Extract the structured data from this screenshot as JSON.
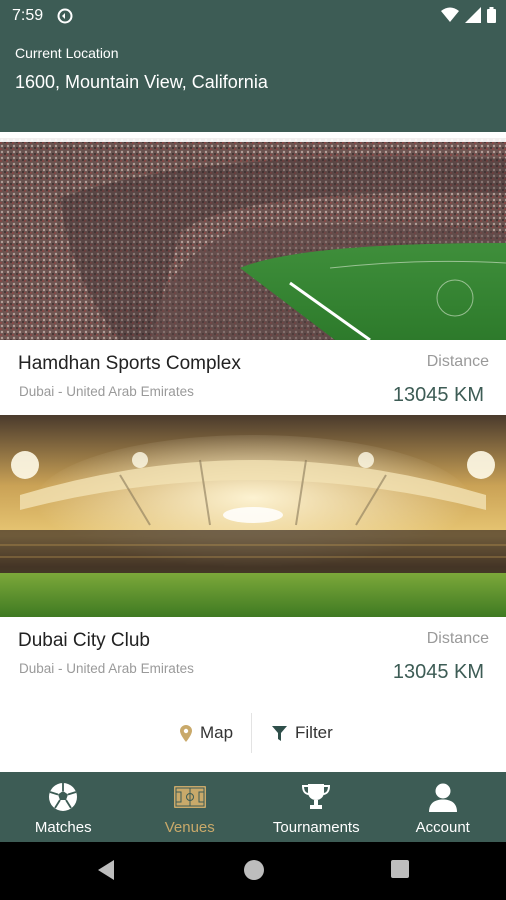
{
  "status_bar": {
    "time": "7:59"
  },
  "header": {
    "label": "Current Location",
    "location": "1600, Mountain View, California"
  },
  "venues": [
    {
      "name": "Hamdhan Sports Complex",
      "country": "Dubai - United Arab Emirates",
      "distance_label": "Distance",
      "distance_value": "13045 KM"
    },
    {
      "name": "Dubai City Club",
      "country": "Dubai - United Arab Emirates",
      "distance_label": "Distance",
      "distance_value": "13045 KM"
    }
  ],
  "actions": {
    "map_label": "Map",
    "filter_label": "Filter"
  },
  "bottom_nav": {
    "items": [
      {
        "label": "Matches",
        "icon": "soccer-ball-icon"
      },
      {
        "label": "Venues",
        "icon": "field-icon",
        "active": true
      },
      {
        "label": "Tournaments",
        "icon": "trophy-icon"
      },
      {
        "label": "Account",
        "icon": "person-icon"
      }
    ]
  },
  "colors": {
    "primary": "#3d5c55",
    "accent": "#c9a96a",
    "muted": "#9a9a9a"
  }
}
